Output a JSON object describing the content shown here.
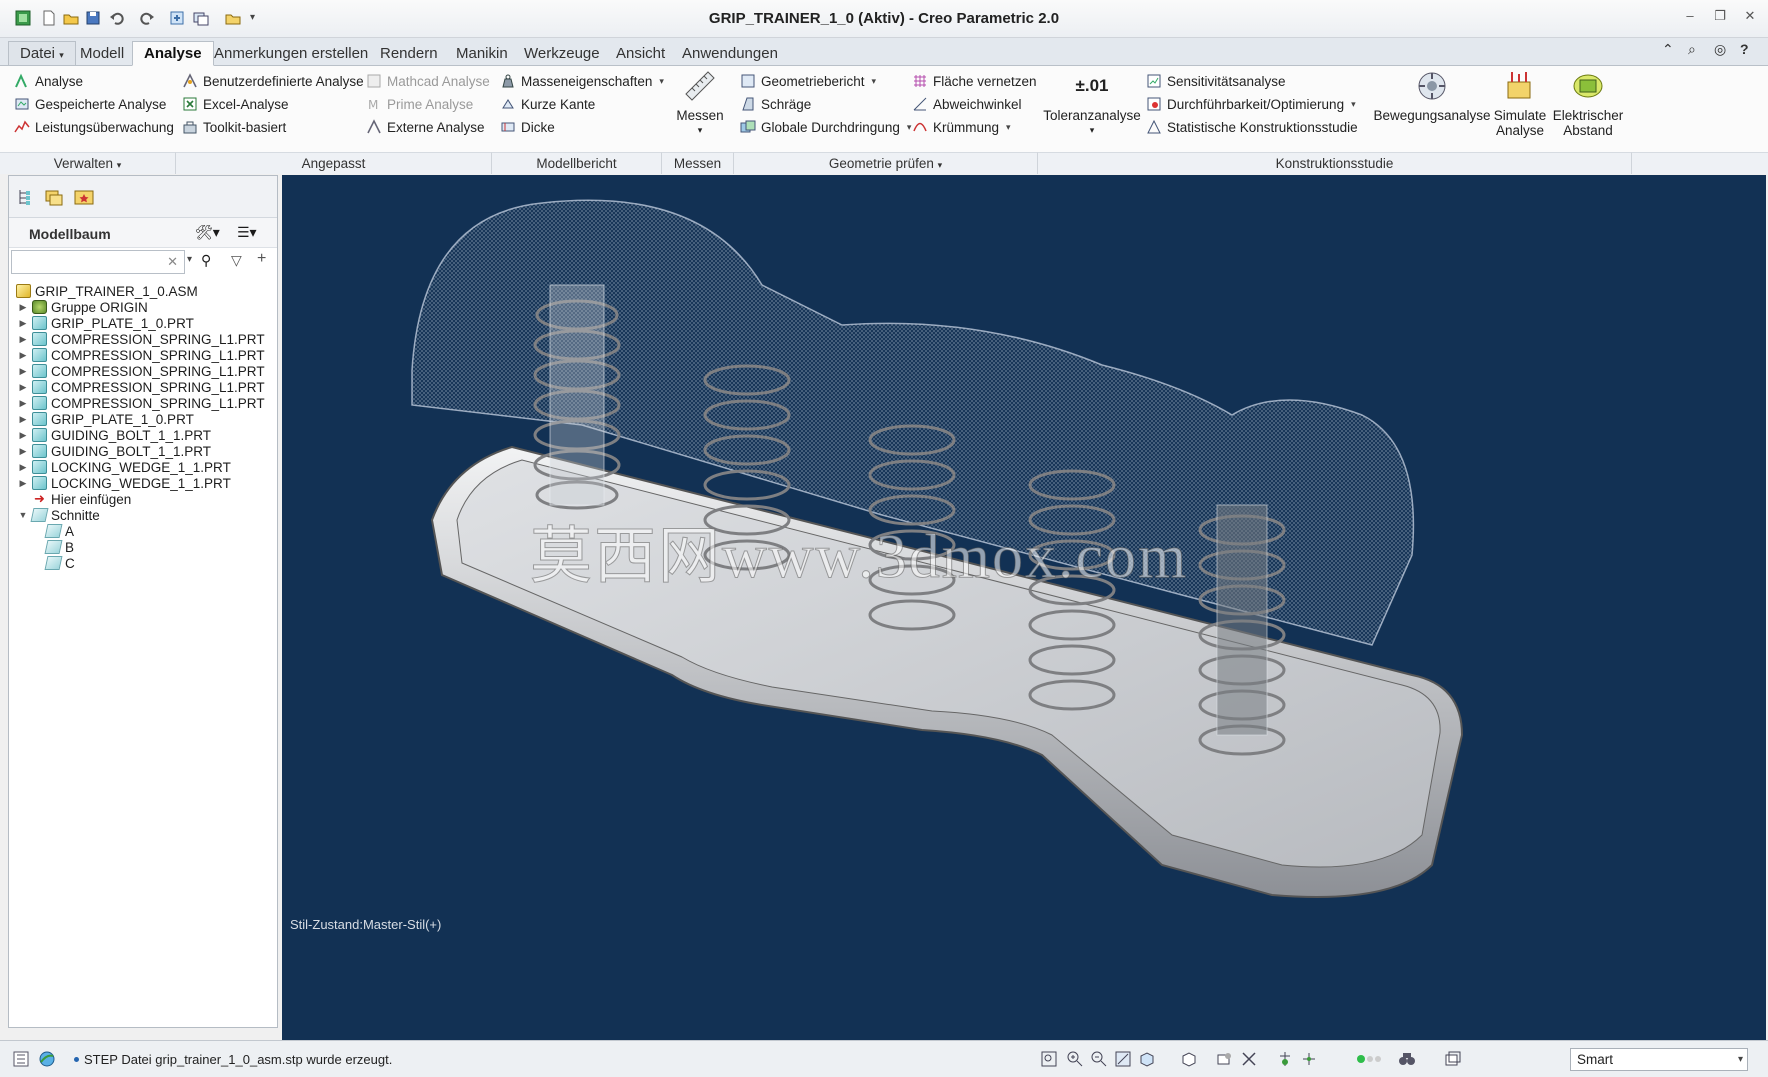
{
  "window": {
    "title": "GRIP_TRAINER_1_0 (Aktiv) - Creo Parametric 2.0"
  },
  "menu_tabs": [
    {
      "label": "Datei",
      "has_dropdown": true
    },
    {
      "label": "Modell"
    },
    {
      "label": "Analyse",
      "active": true
    },
    {
      "label": "Anmerkungen erstellen"
    },
    {
      "label": "Rendern"
    },
    {
      "label": "Manikin"
    },
    {
      "label": "Werkzeuge"
    },
    {
      "label": "Ansicht"
    },
    {
      "label": "Anwendungen"
    }
  ],
  "ribbon": {
    "verwalten": {
      "items": [
        "Analyse",
        "Gespeicherte Analyse",
        "Leistungsüberwachung"
      ],
      "group_label": "Verwalten"
    },
    "angepasst": {
      "items": [
        "Benutzerdefinierte Analyse",
        "Excel-Analyse",
        "Toolkit-basiert"
      ],
      "disabled_items": [
        "Mathcad Analyse",
        "Prime Analyse"
      ],
      "extra": "Externe Analyse",
      "group_label": "Angepasst"
    },
    "modellbericht": {
      "items": [
        "Masseneigenschaften",
        "Kurze Kante",
        "Dicke"
      ],
      "group_label": "Modellbericht"
    },
    "messen": {
      "big": "Messen",
      "group_label": "Messen"
    },
    "geometrie": {
      "col1": [
        "Geometriebericht",
        "Schräge",
        "Globale Durchdringung"
      ],
      "col2": [
        "Fläche vernetzen",
        "Abweichwinkel",
        "Krümmung"
      ],
      "group_label": "Geometrie prüfen"
    },
    "konstruktion": {
      "toleranz_icon_text": "±.01",
      "toleranz": "Toleranzanalyse",
      "items": [
        "Sensitivitätsanalyse",
        "Durchführbarkeit/Optimierung",
        "Statistische Konstruktionsstudie"
      ],
      "big": [
        "Bewegungsanalyse",
        "Simulate Analyse",
        "Elektrischer Abstand"
      ],
      "group_label": "Konstruktionsstudie"
    }
  },
  "left_panel": {
    "header": "Modellbaum",
    "tree": [
      {
        "label": "GRIP_TRAINER_1_0.ASM",
        "type": "asm",
        "level": 0
      },
      {
        "label": "Gruppe ORIGIN",
        "type": "group",
        "level": 1
      },
      {
        "label": "GRIP_PLATE_1_0.PRT",
        "type": "prt",
        "level": 1
      },
      {
        "label": "COMPRESSION_SPRING_L1.PRT",
        "type": "prt",
        "level": 1
      },
      {
        "label": "COMPRESSION_SPRING_L1.PRT",
        "type": "prt",
        "level": 1
      },
      {
        "label": "COMPRESSION_SPRING_L1.PRT",
        "type": "prt",
        "level": 1
      },
      {
        "label": "COMPRESSION_SPRING_L1.PRT",
        "type": "prt",
        "level": 1
      },
      {
        "label": "COMPRESSION_SPRING_L1.PRT",
        "type": "prt",
        "level": 1
      },
      {
        "label": "GRIP_PLATE_1_0.PRT",
        "type": "prt",
        "level": 1
      },
      {
        "label": "GUIDING_BOLT_1_1.PRT",
        "type": "prt",
        "level": 1
      },
      {
        "label": "GUIDING_BOLT_1_1.PRT",
        "type": "prt",
        "level": 1
      },
      {
        "label": "LOCKING_WEDGE_1_1.PRT",
        "type": "prt",
        "level": 1
      },
      {
        "label": "LOCKING_WEDGE_1_1.PRT",
        "type": "prt",
        "level": 1
      },
      {
        "label": "Hier einfügen",
        "type": "insert",
        "level": 1
      },
      {
        "label": "Schnitte",
        "type": "folder",
        "level": 1,
        "expanded": true
      },
      {
        "label": "A",
        "type": "section",
        "level": 2
      },
      {
        "label": "B",
        "type": "section",
        "level": 2
      },
      {
        "label": "C",
        "type": "section",
        "level": 2
      }
    ]
  },
  "viewport": {
    "style_state": "Stil-Zustand:Master-Stil(+)",
    "watermark": "莫西网www.3dmox.com"
  },
  "status": {
    "message": "STEP Datei grip_trainer_1_0_asm.stp wurde erzeugt.",
    "selection_filter": "Smart"
  },
  "colors": {
    "viewport_bg": "#123154",
    "ribbon_bg": "#fbfbfb"
  }
}
